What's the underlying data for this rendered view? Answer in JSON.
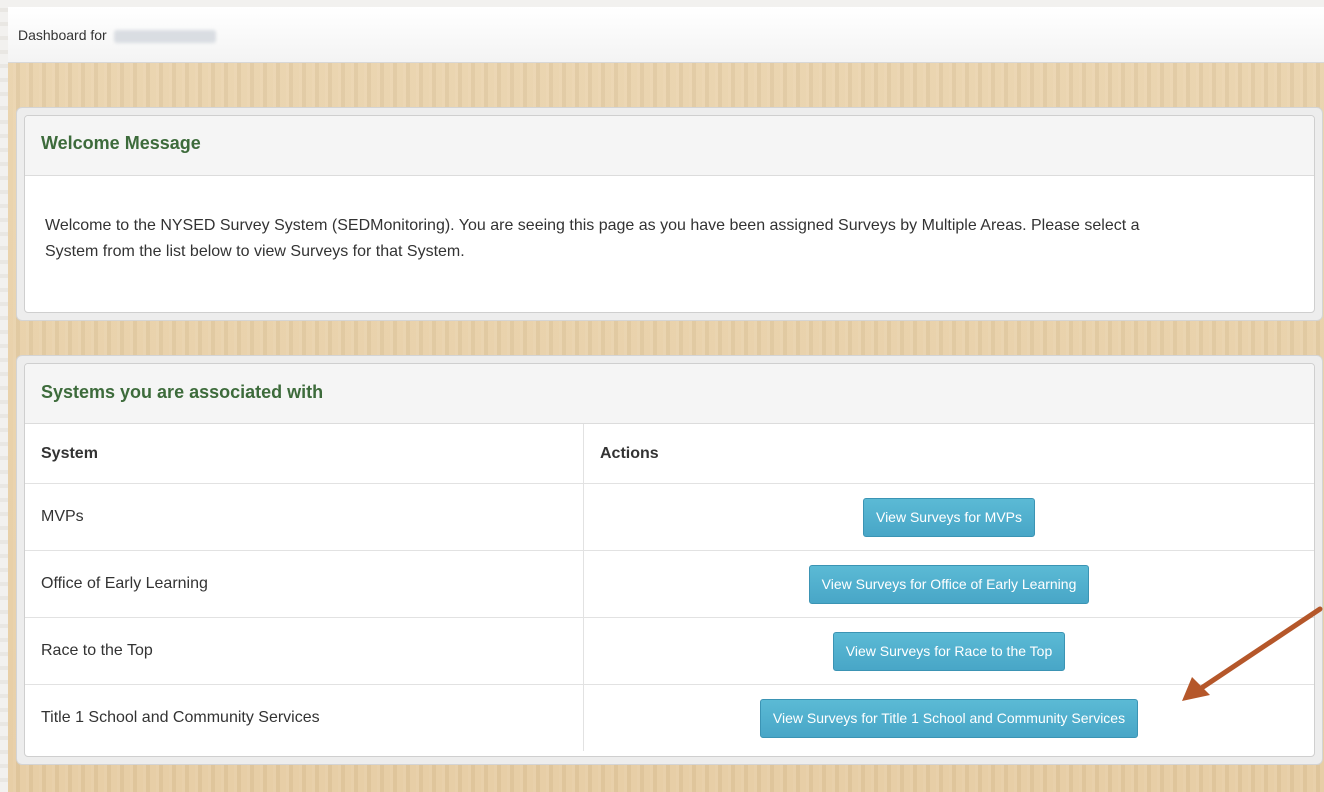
{
  "header": {
    "dashboard_label": "Dashboard for"
  },
  "welcome": {
    "title": "Welcome Message",
    "line1": "Welcome to the NYSED Survey System (SEDMonitoring). You are seeing this page as you have been assigned Surveys by Multiple Areas. Please select a",
    "line2": "System from the list below to view Surveys for that System."
  },
  "systems": {
    "title": "Systems you are associated with",
    "columns": [
      "System",
      "Actions"
    ],
    "rows": [
      {
        "name": "MVPs",
        "action": "View Surveys for MVPs"
      },
      {
        "name": "Office of Early Learning",
        "action": "View Surveys for Office of Early Learning"
      },
      {
        "name": "Race to the Top",
        "action": "View Surveys for Race to the Top"
      },
      {
        "name": "Title 1 School and Community Services",
        "action": "View Surveys for Title 1 School and Community Services"
      }
    ]
  },
  "colors": {
    "heading_green": "#3d6b3b",
    "button_blue": "#5bbad5",
    "arrow": "#b5572a"
  }
}
